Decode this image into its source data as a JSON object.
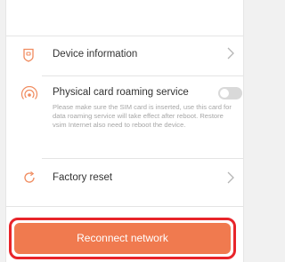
{
  "colors": {
    "accent": "#f07a4f",
    "highlight": "#e8242a",
    "icon": "#f08a5d"
  },
  "rows": [
    {
      "label": "Device information",
      "icon": "phone-shield-icon"
    },
    {
      "label": "Physical card roaming service",
      "icon": "signal-broadcast-icon",
      "toggle_on": false,
      "description": "Please make sure the SIM card is inserted, use this card for data roaming service will take effect after reboot. Restore vsim Internet also need to reboot the device."
    },
    {
      "label": "Factory reset",
      "icon": "reset-icon"
    }
  ],
  "button": {
    "label": "Reconnect network"
  }
}
